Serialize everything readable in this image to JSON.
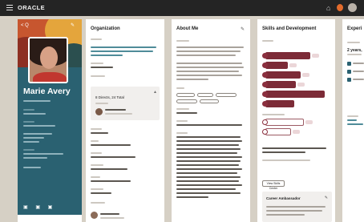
{
  "header": {
    "logo": "ORACLE",
    "menu_icon": "hamburger-icon",
    "home_icon": "home-icon",
    "notifications_icon": "bell-icon",
    "avatar_icon": "user-avatar-icon"
  },
  "profile": {
    "nav_label": "< Q",
    "name": "Marie Avery",
    "social_icons": [
      "calendar-icon",
      "linkedin-icon",
      "network-icon"
    ]
  },
  "organization": {
    "title": "Organization",
    "manager_count": "8 Directs, 24 Total"
  },
  "about": {
    "title": "About Me"
  },
  "skills": {
    "title": "Skills and Development",
    "button_label": "View Skills Center",
    "ambassador_title": "Career Ambassador"
  },
  "experience": {
    "title": "Experi",
    "tenure": "2 years,"
  },
  "colors": {
    "header_bg": "#242424",
    "profile_bg": "#2a6171",
    "skill_chip": "#7c2b37"
  }
}
